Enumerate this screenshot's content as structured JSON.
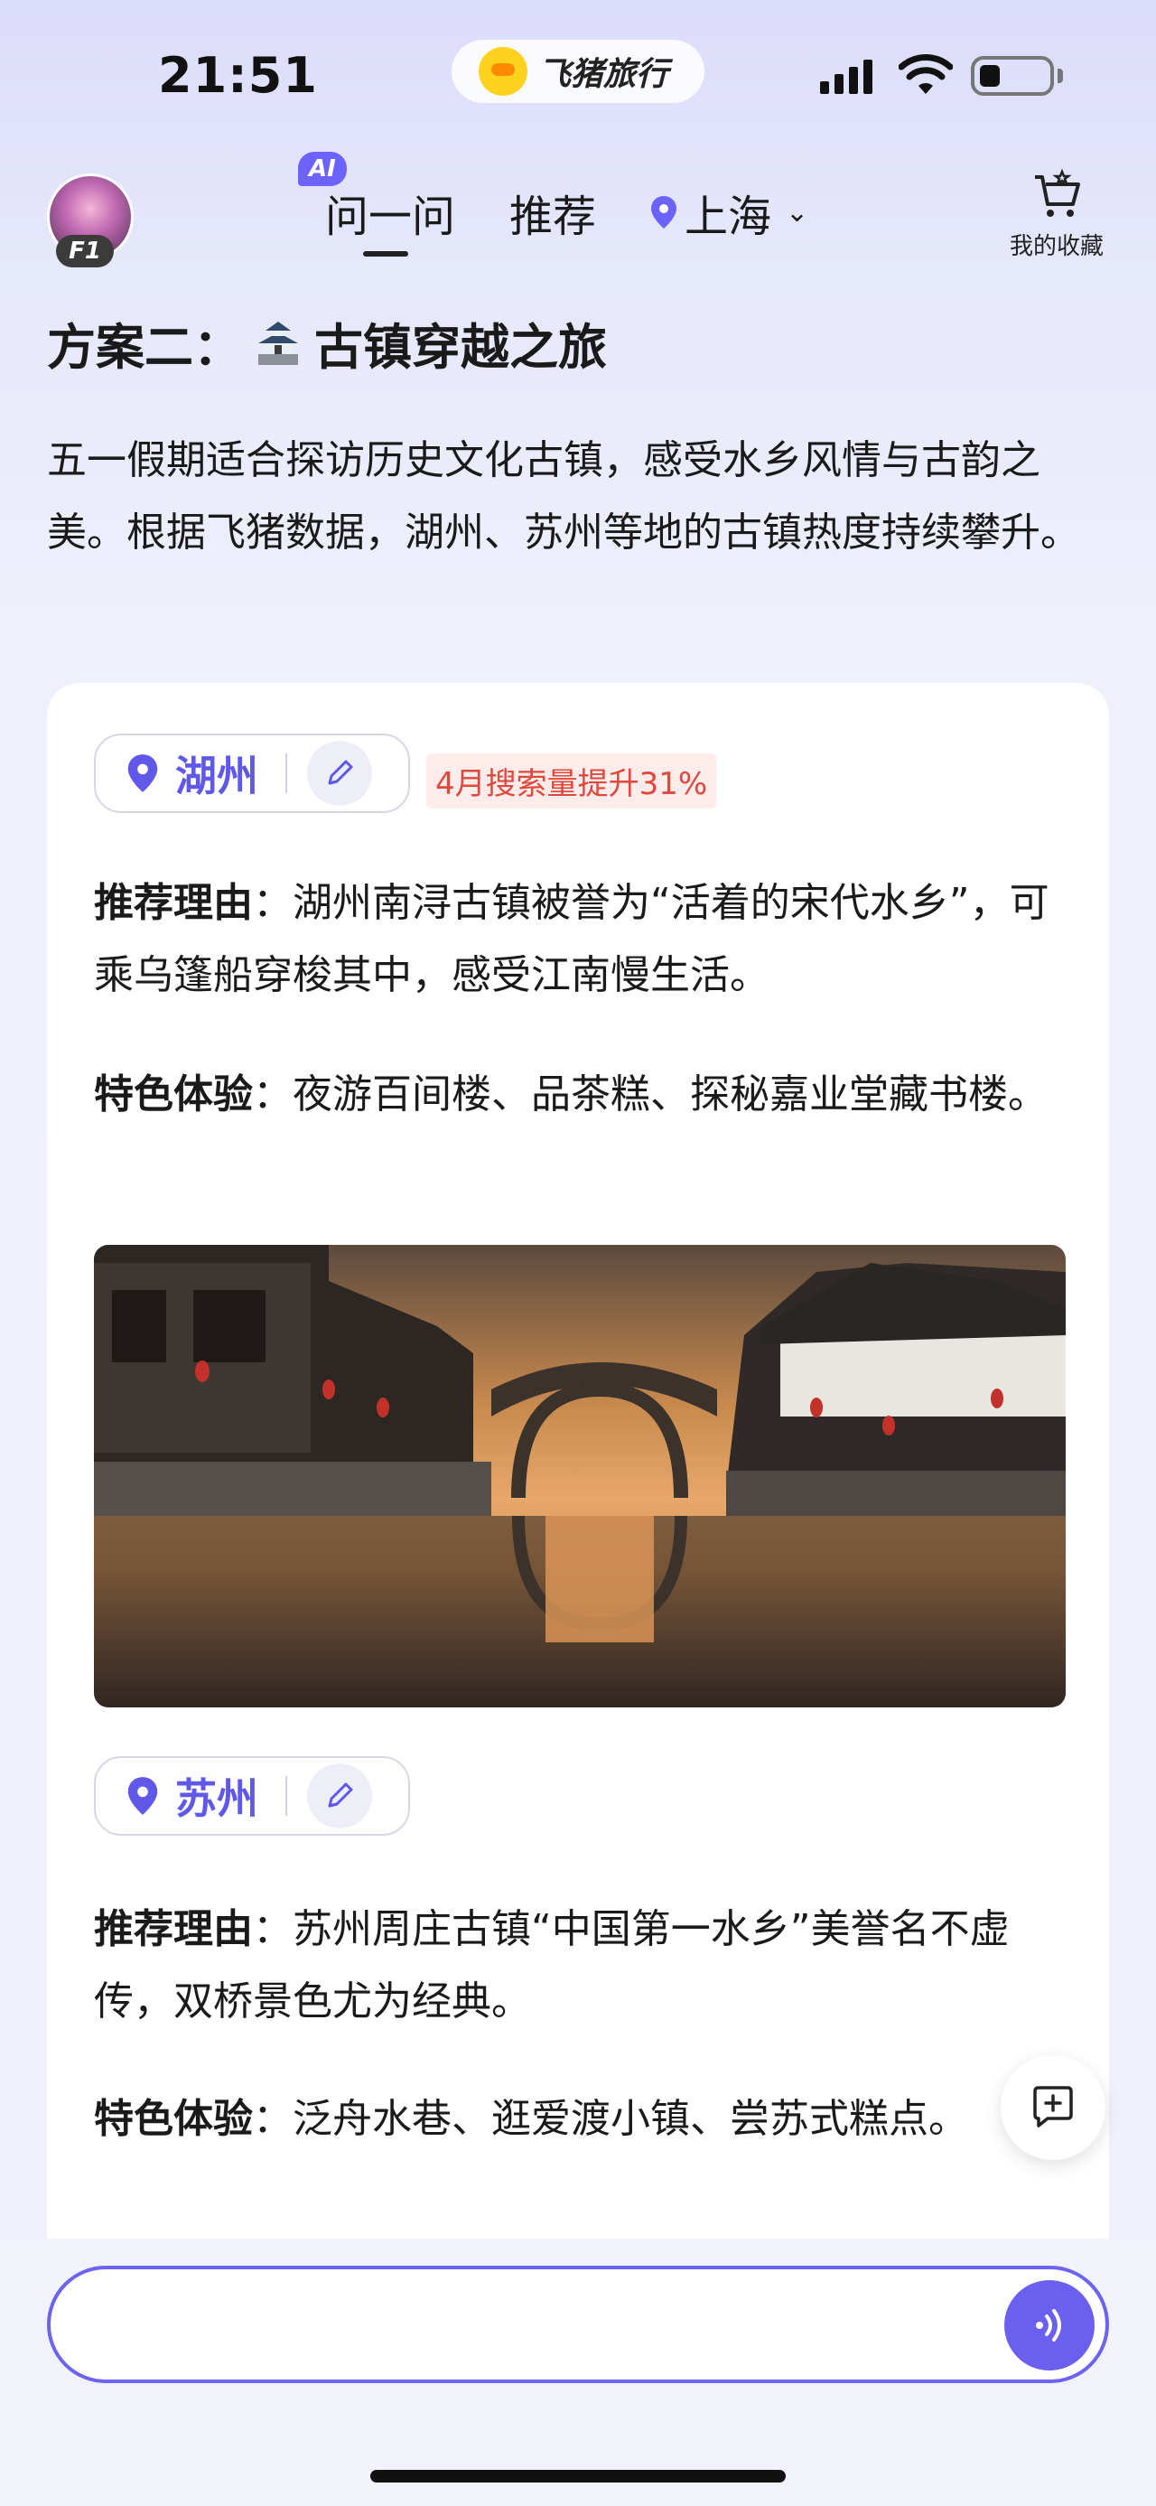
{
  "status_bar": {
    "time": "21:51",
    "app_pill_label": "飞猪旅行"
  },
  "header": {
    "avatar_badge": "F1",
    "ai_badge": "AI",
    "nav": [
      {
        "label": "问一问"
      },
      {
        "label": "推荐"
      }
    ],
    "location": "上海",
    "favorites_label": "我的收藏"
  },
  "main": {
    "plan_title": "方案二：",
    "plan_title_suffix": "古镇穿越之旅",
    "intro": "五一假期适合探访历史文化古镇，感受水乡风情与古韵之美。根据飞猪数据，湖州、苏州等地的古镇热度持续攀升。"
  },
  "destinations": [
    {
      "city": "湖州",
      "trend": "4月搜索量提升31%",
      "reason_label": "推荐理由",
      "reason": "：湖州南浔古镇被誉为“活着的宋代水乡”，可乘乌篷船穿梭其中，感受江南慢生活。",
      "exp_label": "特色体验",
      "exp": "：夜游百间楼、品茶糕、探秘嘉业堂藏书楼。"
    },
    {
      "city": "苏州",
      "reason_label": "推荐理由",
      "reason": "：苏州周庄古镇“中国第一水乡”美誉名不虚传，双桥景色尤为经典。",
      "exp_label": "特色体验",
      "exp": "：泛舟水巷、逛爱渡小镇、尝苏式糕点。"
    }
  ],
  "input": {
    "placeholder": ""
  },
  "colors": {
    "accent": "#5f58e8",
    "trend_red": "#e0483e",
    "voice_button": "#6b5ff0"
  },
  "icons": [
    "location-pin-icon",
    "edit-pencil-icon",
    "cart-icon",
    "chevron-down-icon",
    "castle-icon",
    "chat-add-icon",
    "voice-wave-icon",
    "wifi-icon",
    "battery-icon",
    "signal-icon"
  ]
}
